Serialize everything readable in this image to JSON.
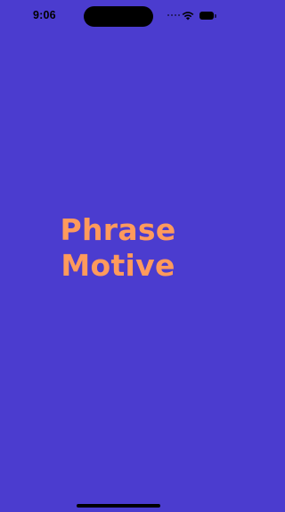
{
  "status_bar": {
    "time": "9:06",
    "wifi_icon": "wifi-icon",
    "battery_icon": "battery-icon",
    "battery_level": 1.0
  },
  "splash": {
    "title_line_1": "Phrase",
    "title_line_2": "Motive"
  },
  "colors": {
    "background": "#4b3ccf",
    "title": "#ff9a5c",
    "status_foreground": "#000000"
  }
}
